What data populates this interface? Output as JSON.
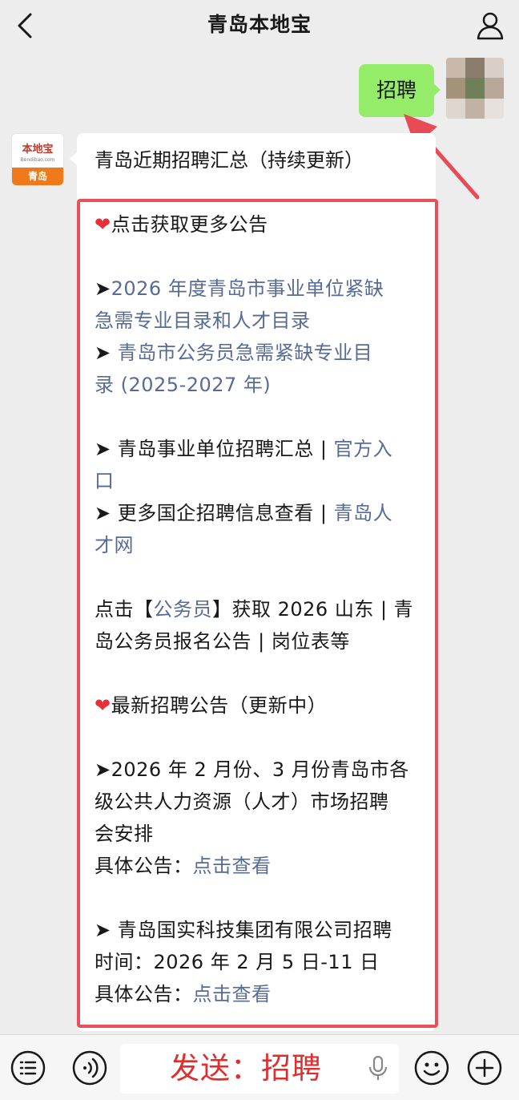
{
  "header": {
    "title": "青岛本地宝"
  },
  "outgoing": {
    "text": "招聘"
  },
  "bot_avatar": {
    "logo_text": "本地宝",
    "logo_url": "Bendibao.com",
    "city": "青岛"
  },
  "incoming": {
    "title": "青岛近期招聘汇总（持续更新）",
    "lines": {
      "l1": "点击获取更多公告",
      "l2_prefix": "➤",
      "l2_link": "2026 年度青岛市事业单位紧缺",
      "l3_link": "急需专业目录和人才目录",
      "l4_prefix": "➤ ",
      "l4_link": "青岛市公务员急需紧缺专业目",
      "l5_link": "录 (2025-2027 年)",
      "l6_text": "➤ 青岛事业单位招聘汇总 | ",
      "l6_link": "官方入",
      "l7_link": "口",
      "l8_text": "➤ 更多国企招聘信息查看 | ",
      "l8_link": "青岛人",
      "l9_link": "才网",
      "l10_a": "点击【",
      "l10_link": "公务员",
      "l10_b": "】获取 2026 山东 | 青",
      "l11": "岛公务员报名公告 | 岗位表等",
      "l12": "最新招聘公告（更新中）",
      "l13": "➤2026 年 2 月份、3 月份青岛市各",
      "l14": "级公共人力资源（人才）市场招聘",
      "l15": "会安排",
      "l16_a": "具体公告：",
      "l16_link": "点击查看",
      "l17": "➤ 青岛国实科技集团有限公司招聘",
      "l18": "时间：2026 年 2 月 5 日-11 日",
      "l19_a": "具体公告：",
      "l19_link": "点击查看"
    },
    "heart_glyph": "❤"
  },
  "input": {
    "text": "发送：招聘"
  },
  "colors": {
    "highlight_border": "#e8505b",
    "link": "#576b95",
    "bubble_out": "#95ec69",
    "input_text": "#e02e2e"
  }
}
